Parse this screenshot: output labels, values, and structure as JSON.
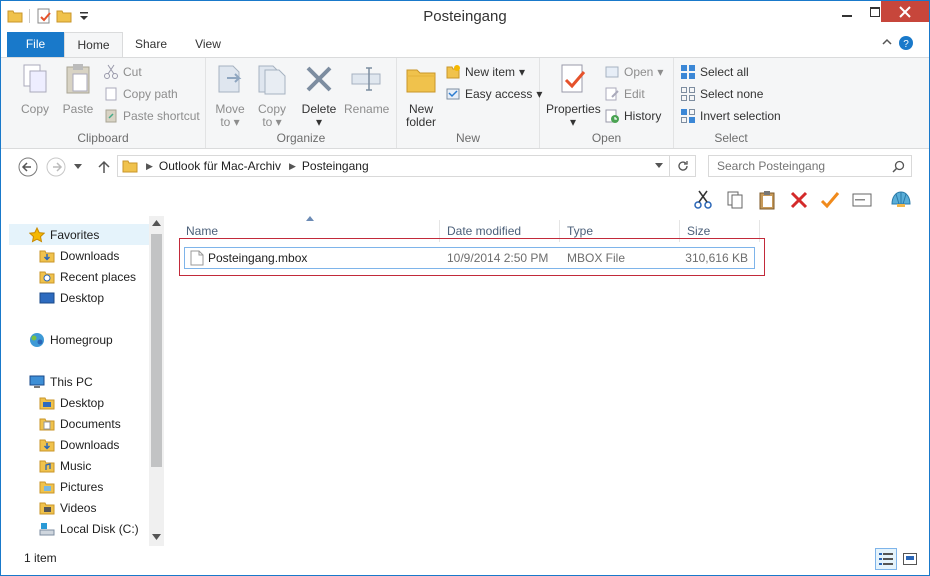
{
  "window": {
    "title": "Posteingang"
  },
  "tabs": [
    {
      "label": "File"
    },
    {
      "label": "Home"
    },
    {
      "label": "Share"
    },
    {
      "label": "View"
    }
  ],
  "ribbon": {
    "clipboard": {
      "label": "Clipboard",
      "copy": "Copy",
      "paste": "Paste",
      "cut": "Cut",
      "copy_path": "Copy path",
      "paste_shortcut": "Paste shortcut"
    },
    "organize": {
      "label": "Organize",
      "move_to_1": "Move",
      "move_to_2": "to",
      "copy_to_1": "Copy",
      "copy_to_2": "to",
      "delete": "Delete",
      "rename": "Rename"
    },
    "new": {
      "label": "New",
      "new_folder_1": "New",
      "new_folder_2": "folder",
      "new_item": "New item",
      "easy_access": "Easy access"
    },
    "open": {
      "label": "Open",
      "properties": "Properties",
      "open": "Open",
      "edit": "Edit",
      "history": "History"
    },
    "select": {
      "label": "Select",
      "select_all": "Select all",
      "select_none": "Select none",
      "invert_selection": "Invert selection"
    }
  },
  "address": {
    "crumbs": [
      "Outlook für Mac-Archiv",
      "Posteingang"
    ],
    "search_placeholder": "Search Posteingang"
  },
  "navpane": {
    "favorites": "Favorites",
    "downloads": "Downloads",
    "recent_places": "Recent places",
    "desktop": "Desktop",
    "homegroup": "Homegroup",
    "this_pc": "This PC",
    "pc_desktop": "Desktop",
    "documents": "Documents",
    "pc_downloads": "Downloads",
    "music": "Music",
    "pictures": "Pictures",
    "videos": "Videos",
    "local_disk": "Local Disk (C:)"
  },
  "columns": {
    "name": "Name",
    "date_modified": "Date modified",
    "type": "Type",
    "size": "Size"
  },
  "files": [
    {
      "name": "Posteingang.mbox",
      "date_modified": "10/9/2014 2:50 PM",
      "type": "MBOX File",
      "size": "310,616 KB"
    }
  ],
  "status": {
    "item_count": "1 item"
  }
}
